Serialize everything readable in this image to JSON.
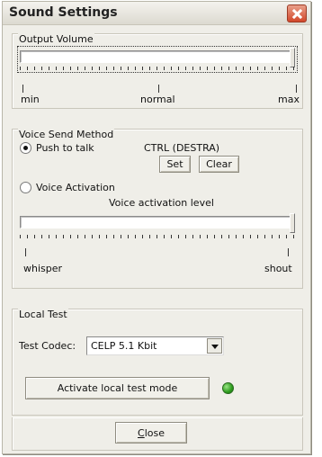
{
  "window": {
    "title": "Sound Settings"
  },
  "output_volume": {
    "legend": "Output Volume",
    "level_fraction": 1.0,
    "labels": {
      "min": "min",
      "normal": "normal",
      "max": "max"
    }
  },
  "voice_send": {
    "legend": "Voice Send Method",
    "push_to_talk_label": "Push to talk",
    "push_to_talk_selected": true,
    "hotkey": "CTRL (DESTRA)",
    "set_label": "Set",
    "clear_label": "Clear",
    "voice_activation_label": "Voice Activation",
    "voice_activation_level_label": "Voice activation level",
    "activation_level_fraction": 1.0,
    "labels": {
      "low": "whisper",
      "high": "shout"
    }
  },
  "local_test": {
    "legend": "Local Test",
    "codec_label": "Test Codec:",
    "codec_value": "CELP 5.1 Kbit",
    "activate_label": "Activate local test mode",
    "indicator_color": "#2c9b1d"
  },
  "footer": {
    "close_label_first": "C",
    "close_label_rest": "lose"
  }
}
